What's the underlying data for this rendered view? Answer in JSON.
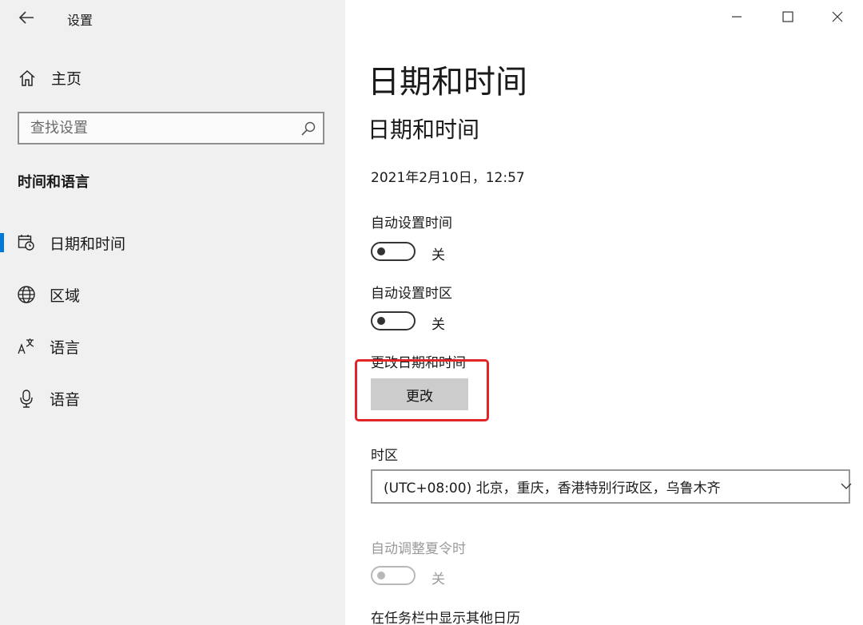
{
  "window": {
    "title": "设置"
  },
  "sidebar": {
    "home_label": "主页",
    "search_placeholder": "查找设置",
    "section_title": "时间和语言",
    "items": [
      {
        "label": "日期和时间",
        "icon": "calendar-clock-icon",
        "active": true
      },
      {
        "label": "区域",
        "icon": "globe-icon",
        "active": false
      },
      {
        "label": "语言",
        "icon": "language-icon",
        "active": false
      },
      {
        "label": "语音",
        "icon": "microphone-icon",
        "active": false
      }
    ]
  },
  "main": {
    "page_title": "日期和时间",
    "section_title": "日期和时间",
    "current_datetime": "2021年2月10日，12:57",
    "auto_time": {
      "label": "自动设置时间",
      "state": "关"
    },
    "auto_timezone": {
      "label": "自动设置时区",
      "state": "关"
    },
    "change_datetime": {
      "label": "更改日期和时间",
      "button": "更改"
    },
    "timezone": {
      "label": "时区",
      "value": "(UTC+08:00) 北京，重庆，香港特别行政区，乌鲁木齐"
    },
    "dst": {
      "label": "自动调整夏令时",
      "state": "关"
    },
    "taskbar_calendar": {
      "label": "在任务栏中显示其他日历"
    }
  },
  "colors": {
    "accent": "#0078d7",
    "highlight": "#e0262a",
    "sidebar_bg": "#f0f0f0"
  }
}
